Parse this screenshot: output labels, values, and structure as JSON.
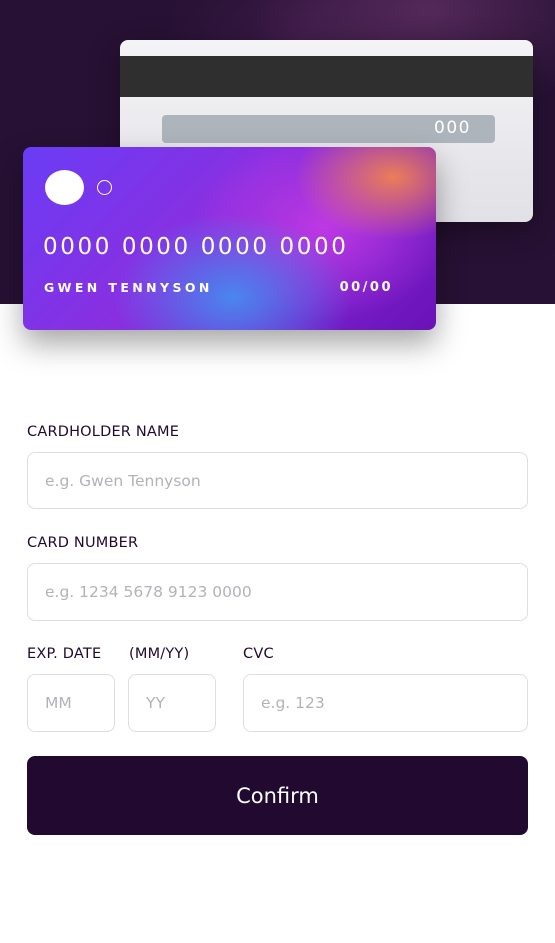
{
  "colors": {
    "hero_background": "#271134",
    "primary_dark": "#21092f",
    "input_border": "#dedddf",
    "placeholder": "#b5b1b8"
  },
  "card_back": {
    "cvc": "000"
  },
  "card_front": {
    "number": "0000 0000 0000 0000",
    "holder_name": "GWEN TENNYSON",
    "expiry": "00/00"
  },
  "form": {
    "cardholder_label": "CARDHOLDER NAME",
    "cardholder_placeholder": "e.g. Gwen Tennyson",
    "cardholder_value": "",
    "number_label": "CARD NUMBER",
    "number_placeholder": "e.g. 1234 5678 9123 0000",
    "number_value": "",
    "exp_label": "EXP. DATE",
    "exp_format_label": "(MM/YY)",
    "month_placeholder": "MM",
    "month_value": "",
    "year_placeholder": "YY",
    "year_value": "",
    "cvc_label": "CVC",
    "cvc_placeholder": "e.g. 123",
    "cvc_value": "",
    "confirm_label": "Confirm"
  }
}
